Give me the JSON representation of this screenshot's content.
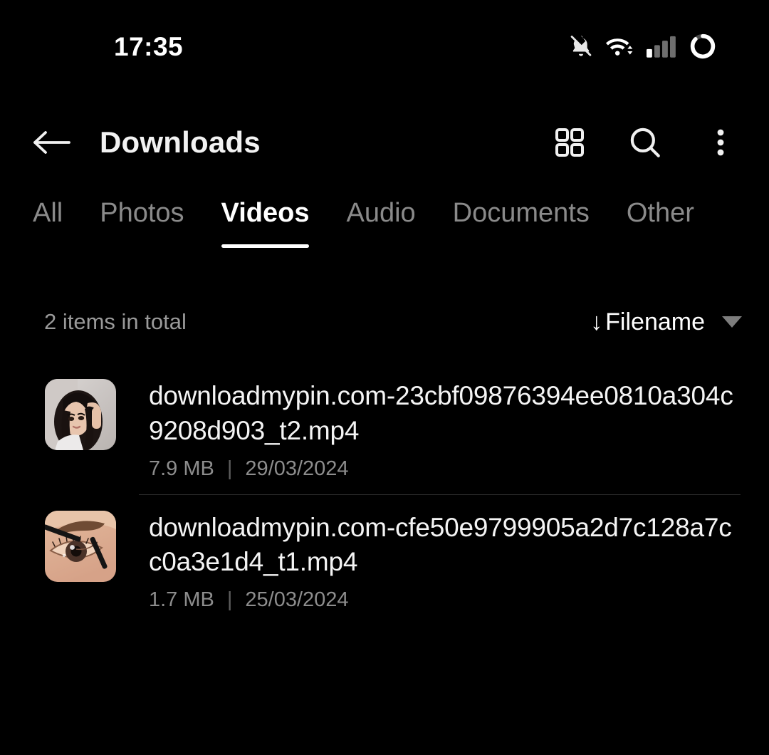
{
  "statusbar": {
    "time": "17:35",
    "icons": [
      {
        "name": "notifications-muted-icon",
        "label": "notifications muted"
      },
      {
        "name": "wifi-icon",
        "label": "wifi connected"
      },
      {
        "name": "signal-bars-icon",
        "label": "cellular signal"
      },
      {
        "name": "battery-ring-icon",
        "label": "battery"
      }
    ]
  },
  "appbar": {
    "back_label": "Back",
    "title": "Downloads",
    "actions": [
      {
        "name": "grid-view-icon",
        "label": "Grid view"
      },
      {
        "name": "search-icon",
        "label": "Search"
      },
      {
        "name": "overflow-menu-icon",
        "label": "More options"
      }
    ]
  },
  "tabs": [
    {
      "label": "All",
      "active": false
    },
    {
      "label": "Photos",
      "active": false
    },
    {
      "label": "Videos",
      "active": true
    },
    {
      "label": "Audio",
      "active": false
    },
    {
      "label": "Documents",
      "active": false
    },
    {
      "label": "Other",
      "active": false
    }
  ],
  "summary": {
    "count_text": "2 items in total",
    "sort_arrow": "↓",
    "sort_label": "Filename"
  },
  "files": [
    {
      "name": "downloadmypin.com-23cbf09876394ee0810a304c9208d903_t2.mp4",
      "size": "7.9 MB",
      "separator": "|",
      "date": "29/03/2024",
      "thumbnail": "woman-braiding-hair-thumbnail"
    },
    {
      "name": "downloadmypin.com-cfe50e9799905a2d7c128a7cc0a3e1d4_t1.mp4",
      "size": "1.7 MB",
      "separator": "|",
      "date": "25/03/2024",
      "thumbnail": "eye-makeup-pencil-thumbnail"
    }
  ],
  "colors": {
    "background": "#000000",
    "primary_text": "#f4f4f4",
    "secondary_text": "#8d8d8d",
    "inactive_tab": "#8a8a8a",
    "divider": "#2e2e2e"
  }
}
